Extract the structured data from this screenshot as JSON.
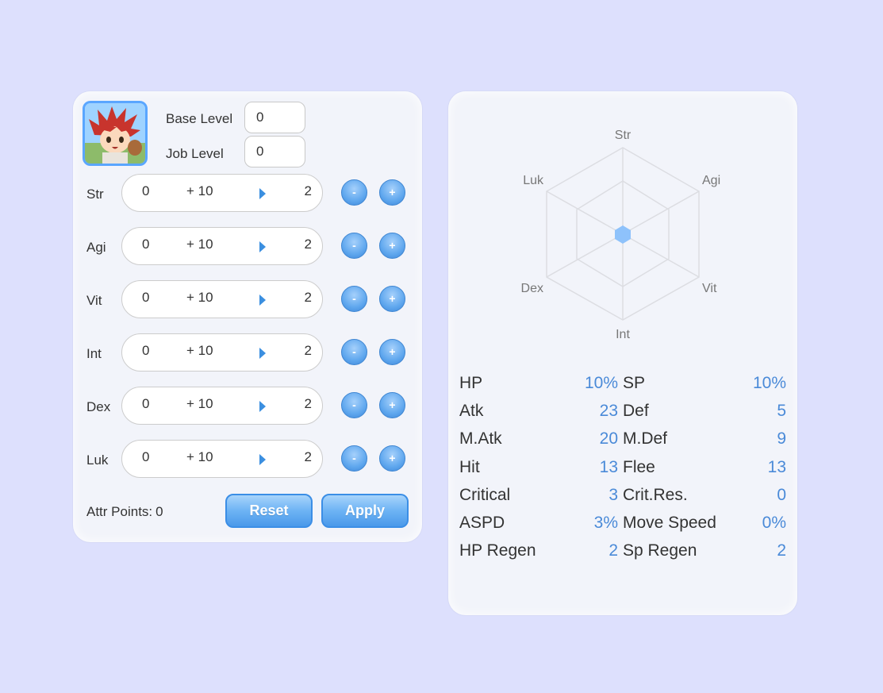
{
  "character": {
    "avatar_alt": "character portrait",
    "base_level_label": "Base Level",
    "base_level_value": "0",
    "job_level_label": "Job Level",
    "job_level_value": "0"
  },
  "attributes": [
    {
      "name": "Str",
      "base": "0",
      "bonus": "+ 10",
      "cost": "2",
      "minus": "-",
      "plus": "+"
    },
    {
      "name": "Agi",
      "base": "0",
      "bonus": "+ 10",
      "cost": "2",
      "minus": "-",
      "plus": "+"
    },
    {
      "name": "Vit",
      "base": "0",
      "bonus": "+ 10",
      "cost": "2",
      "minus": "-",
      "plus": "+"
    },
    {
      "name": "Int",
      "base": "0",
      "bonus": "+ 10",
      "cost": "2",
      "minus": "-",
      "plus": "+"
    },
    {
      "name": "Dex",
      "base": "0",
      "bonus": "+ 10",
      "cost": "2",
      "minus": "-",
      "plus": "+"
    },
    {
      "name": "Luk",
      "base": "0",
      "bonus": "+ 10",
      "cost": "2",
      "minus": "-",
      "plus": "+"
    }
  ],
  "footer": {
    "attr_points_label": "Attr Points:",
    "attr_points_value": "0",
    "reset_label": "Reset",
    "apply_label": "Apply"
  },
  "radar": {
    "labels": {
      "top": "Str",
      "top_right": "Agi",
      "bottom_right": "Vit",
      "bottom": "Int",
      "bottom_left": "Dex",
      "top_left": "Luk"
    }
  },
  "stats": [
    {
      "left_label": "HP",
      "left_value": "10%",
      "right_label": "SP",
      "right_value": "10%"
    },
    {
      "left_label": "Atk",
      "left_value": "23",
      "right_label": "Def",
      "right_value": "5"
    },
    {
      "left_label": "M.Atk",
      "left_value": "20",
      "right_label": "M.Def",
      "right_value": "9"
    },
    {
      "left_label": "Hit",
      "left_value": "13",
      "right_label": "Flee",
      "right_value": "13"
    },
    {
      "left_label": "Critical",
      "left_value": "3",
      "right_label": "Crit.Res.",
      "right_value": "0"
    },
    {
      "left_label": "ASPD",
      "left_value": "3%",
      "right_label": "Move Speed",
      "right_value": "0%"
    },
    {
      "left_label": "HP Regen",
      "left_value": "2",
      "right_label": "Sp Regen",
      "right_value": "2"
    }
  ],
  "colors": {
    "background": "#dde0fd",
    "panel": "#f2f4fa",
    "accent": "#4a99ea",
    "value_text": "#4a8ad8"
  }
}
